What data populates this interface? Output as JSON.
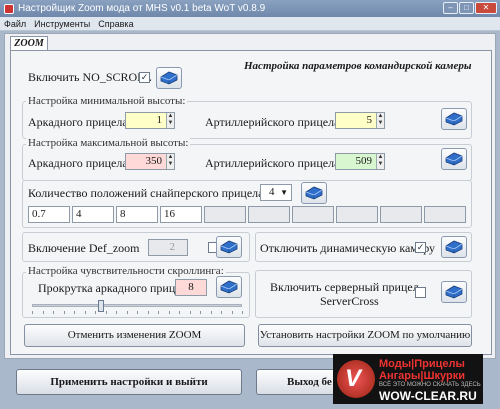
{
  "window": {
    "title": "Настройщик Zoom мода от MHS v0.1 beta   WoT v0.8.9"
  },
  "menu": [
    "Файл",
    "Инструменты",
    "Справка"
  ],
  "tab": "ZOOM",
  "header": "Настройка параметров командирской камеры",
  "no_scroll": {
    "label": "Включить NO_SCROLL",
    "checked": "✓"
  },
  "min_height": {
    "title": "Настройка минимальной высоты:",
    "arcade_label": "Аркадного прицела:",
    "arcade_value": "1",
    "arty_label": "Артиллерийского прицела:",
    "arty_value": "5"
  },
  "max_height": {
    "title": "Настройка максимальной высоты:",
    "arcade_label": "Аркадного прицела:",
    "arcade_value": "350",
    "arty_label": "Артиллерийского прицела:",
    "arty_value": "509"
  },
  "sniper": {
    "label": "Количество положений снайперского прицела:",
    "count": "4",
    "values": [
      "0.7",
      "4",
      "8",
      "16",
      "",
      "",
      "",
      "",
      "",
      ""
    ]
  },
  "def_zoom": {
    "label": "Включение Def_zoom",
    "value": "2",
    "checked": ""
  },
  "dyn_camera": {
    "label": "Отключить динамическую камеру",
    "checked": "✓"
  },
  "scroll_sens": {
    "title": "Настройка чувствительности скроллинга:",
    "label": "Прокрутка аркадного прицела",
    "value": "8",
    "slider_value": 8,
    "slider_max": 100
  },
  "server_cross": {
    "label_line1": "Включить серверный прицел",
    "label_line2": "ServerCross",
    "checked": ""
  },
  "buttons": {
    "revert": "Отменить изменения ZOOM",
    "defaults": "Установить настройки ZOOM по умолчанию",
    "apply_exit": "Применить настройки и выйти",
    "exit": "Выход бе"
  },
  "watermark": {
    "line1": "Моды|Прицелы",
    "line2": "Ангары|Шкурки",
    "line3": "ВСЁ ЭТО МОЖНО СКАЧАТЬ ЗДЕСЬ",
    "line4": "WOW-CLEAR.RU"
  },
  "colors": {
    "yellow_field": "#ffffc8",
    "pink_field": "#ffd8d8",
    "green_field": "#d8f7d0",
    "save_icon": "#2f6fc9"
  }
}
